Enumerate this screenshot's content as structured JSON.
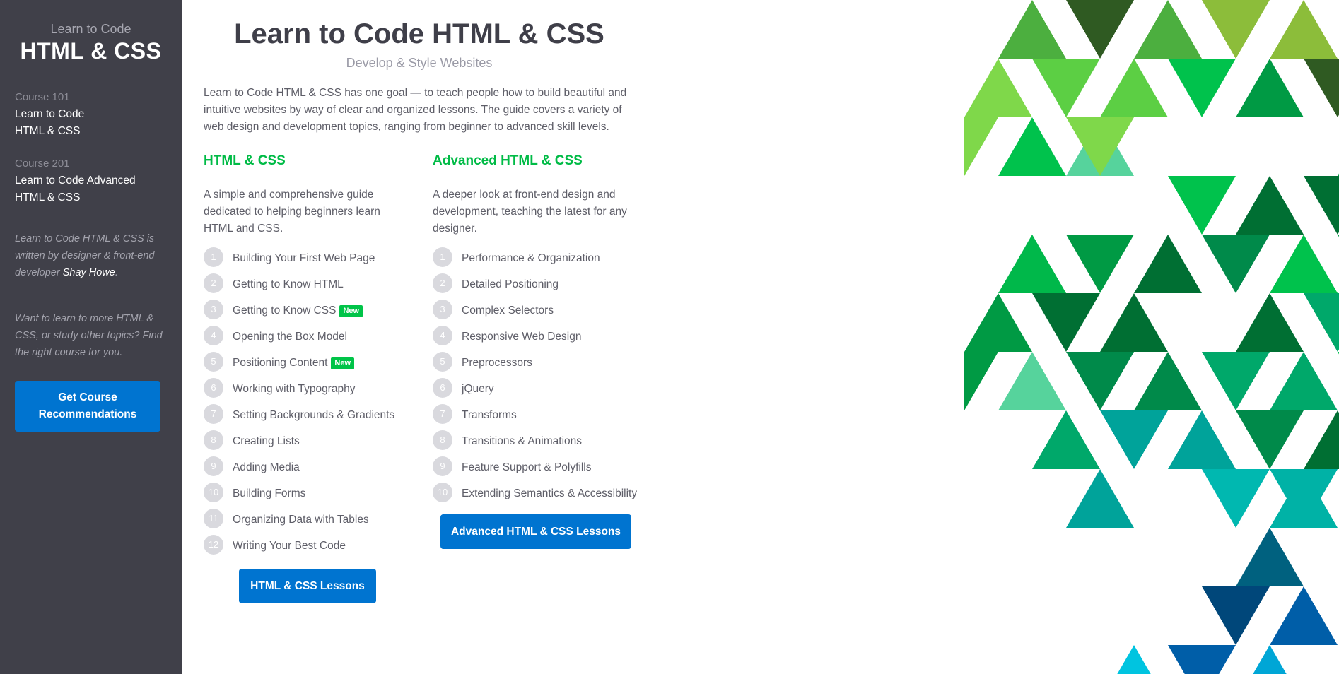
{
  "sidebar": {
    "brand_sub": "Learn to Code",
    "brand_title": "HTML & CSS",
    "courses": [
      {
        "number": "Course 101",
        "title_line1": "Learn to Code",
        "title_line2": "HTML & CSS"
      },
      {
        "number": "Course 201",
        "title_line1": "Learn to Code Advanced",
        "title_line2": "HTML & CSS"
      }
    ],
    "note1_text": "Learn to Code HTML & CSS is written by designer & front-end developer ",
    "note1_link": "Shay Howe",
    "note1_end": ".",
    "note2_text": "Want to learn to more HTML & CSS, or study other topics? Find the right course for you.",
    "button_label": "Get Course Recommendations"
  },
  "main": {
    "title": "Learn to Code HTML & CSS",
    "subtitle": "Develop & Style Websites",
    "intro": "Learn to Code HTML & CSS has one goal — to teach people how to build beautiful and intuitive websites by way of clear and organized lessons. The guide covers a variety of web design and development topics, ranging from beginner to advanced skill levels."
  },
  "course_basic": {
    "title": "HTML & CSS",
    "description": "A simple and comprehensive guide dedicated to helping beginners learn HTML and CSS.",
    "lessons": [
      {
        "num": "1",
        "title": "Building Your First Web Page",
        "badge": ""
      },
      {
        "num": "2",
        "title": "Getting to Know HTML",
        "badge": ""
      },
      {
        "num": "3",
        "title": "Getting to Know CSS",
        "badge": "New"
      },
      {
        "num": "4",
        "title": "Opening the Box Model",
        "badge": ""
      },
      {
        "num": "5",
        "title": "Positioning Content",
        "badge": "New"
      },
      {
        "num": "6",
        "title": "Working with Typography",
        "badge": ""
      },
      {
        "num": "7",
        "title": "Setting Backgrounds & Gradients",
        "badge": ""
      },
      {
        "num": "8",
        "title": "Creating Lists",
        "badge": ""
      },
      {
        "num": "9",
        "title": "Adding Media",
        "badge": ""
      },
      {
        "num": "10",
        "title": "Building Forms",
        "badge": ""
      },
      {
        "num": "11",
        "title": "Organizing Data with Tables",
        "badge": ""
      },
      {
        "num": "12",
        "title": "Writing Your Best Code",
        "badge": ""
      }
    ],
    "button_label": "HTML & CSS Lessons"
  },
  "course_advanced": {
    "title": "Advanced HTML & CSS",
    "description": "A deeper look at front-end design and development, teaching the latest for any designer.",
    "lessons": [
      {
        "num": "1",
        "title": "Performance & Organization",
        "badge": ""
      },
      {
        "num": "2",
        "title": "Detailed Positioning",
        "badge": ""
      },
      {
        "num": "3",
        "title": "Complex Selectors",
        "badge": ""
      },
      {
        "num": "4",
        "title": "Responsive Web Design",
        "badge": ""
      },
      {
        "num": "5",
        "title": "Preprocessors",
        "badge": ""
      },
      {
        "num": "6",
        "title": "jQuery",
        "badge": ""
      },
      {
        "num": "7",
        "title": "Transforms",
        "badge": ""
      },
      {
        "num": "8",
        "title": "Transitions & Animations",
        "badge": ""
      },
      {
        "num": "9",
        "title": "Feature Support & Polyfills",
        "badge": ""
      },
      {
        "num": "10",
        "title": "Extending Semantics & Accessibility",
        "badge": ""
      }
    ],
    "button_label": "Advanced HTML & CSS Lessons"
  },
  "colors": {
    "sidebar_bg": "#404049",
    "accent_green": "#00bb46",
    "button_blue": "#0074d0",
    "badge_green": "#00c448"
  },
  "art_palette": [
    "#4caf3f",
    "#5ccf44",
    "#7fd84a",
    "#8cbd3a",
    "#2f5a22",
    "#00b84a",
    "#00c24c",
    "#009a44",
    "#006f33",
    "#008a4a",
    "#00a86a",
    "#56d39c",
    "#00a39a",
    "#00b8b0",
    "#00b2a6",
    "#00617f",
    "#00477a",
    "#005ea8",
    "#00a6d6",
    "#00c4e0"
  ]
}
